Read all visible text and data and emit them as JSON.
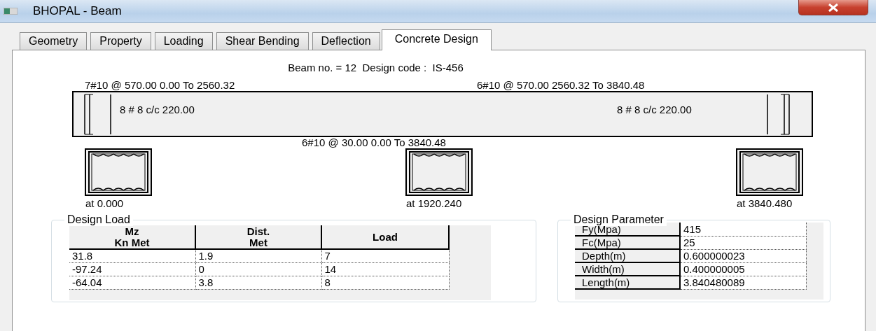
{
  "window": {
    "title": "BHOPAL - Beam"
  },
  "tabs": [
    {
      "label": "Geometry",
      "selected": false
    },
    {
      "label": "Property",
      "selected": false
    },
    {
      "label": "Loading",
      "selected": false
    },
    {
      "label": "Shear Bending",
      "selected": false
    },
    {
      "label": "Deflection",
      "selected": false
    },
    {
      "label": "Concrete Design",
      "selected": true
    }
  ],
  "header": "Beam no. = 12  Design code :  IS-456",
  "beam": {
    "top_left_bars": "7#10 @ 570.00 0.00 To 2560.32",
    "top_right_bars": "6#10 @ 570.00 2560.32 To 3840.48",
    "left_stirrups": "8 # 8 c/c 220.00",
    "right_stirrups": "8 # 8 c/c 220.00",
    "bottom_bars": "6#10 @ 30.00 0.00 To 3840.48"
  },
  "sections": [
    {
      "label": "at 0.000"
    },
    {
      "label": "at 1920.240"
    },
    {
      "label": "at 3840.480"
    }
  ],
  "design_load": {
    "title": "Design Load",
    "columns": [
      "Mz\nKn Met",
      "Dist.\nMet",
      "Load"
    ],
    "rows": [
      [
        "31.8",
        "1.9",
        "7"
      ],
      [
        "-97.24",
        "0",
        "14"
      ],
      [
        "-64.04",
        "3.8",
        "8"
      ]
    ]
  },
  "design_parameter": {
    "title": "Design Parameter",
    "rows": [
      {
        "name": "Fy(Mpa)",
        "value": "415"
      },
      {
        "name": "Fc(Mpa)",
        "value": "25"
      },
      {
        "name": "Depth(m)",
        "value": "0.600000023"
      },
      {
        "name": "Width(m)",
        "value": "0.400000005"
      },
      {
        "name": "Length(m)",
        "value": "3.840480089"
      }
    ]
  }
}
